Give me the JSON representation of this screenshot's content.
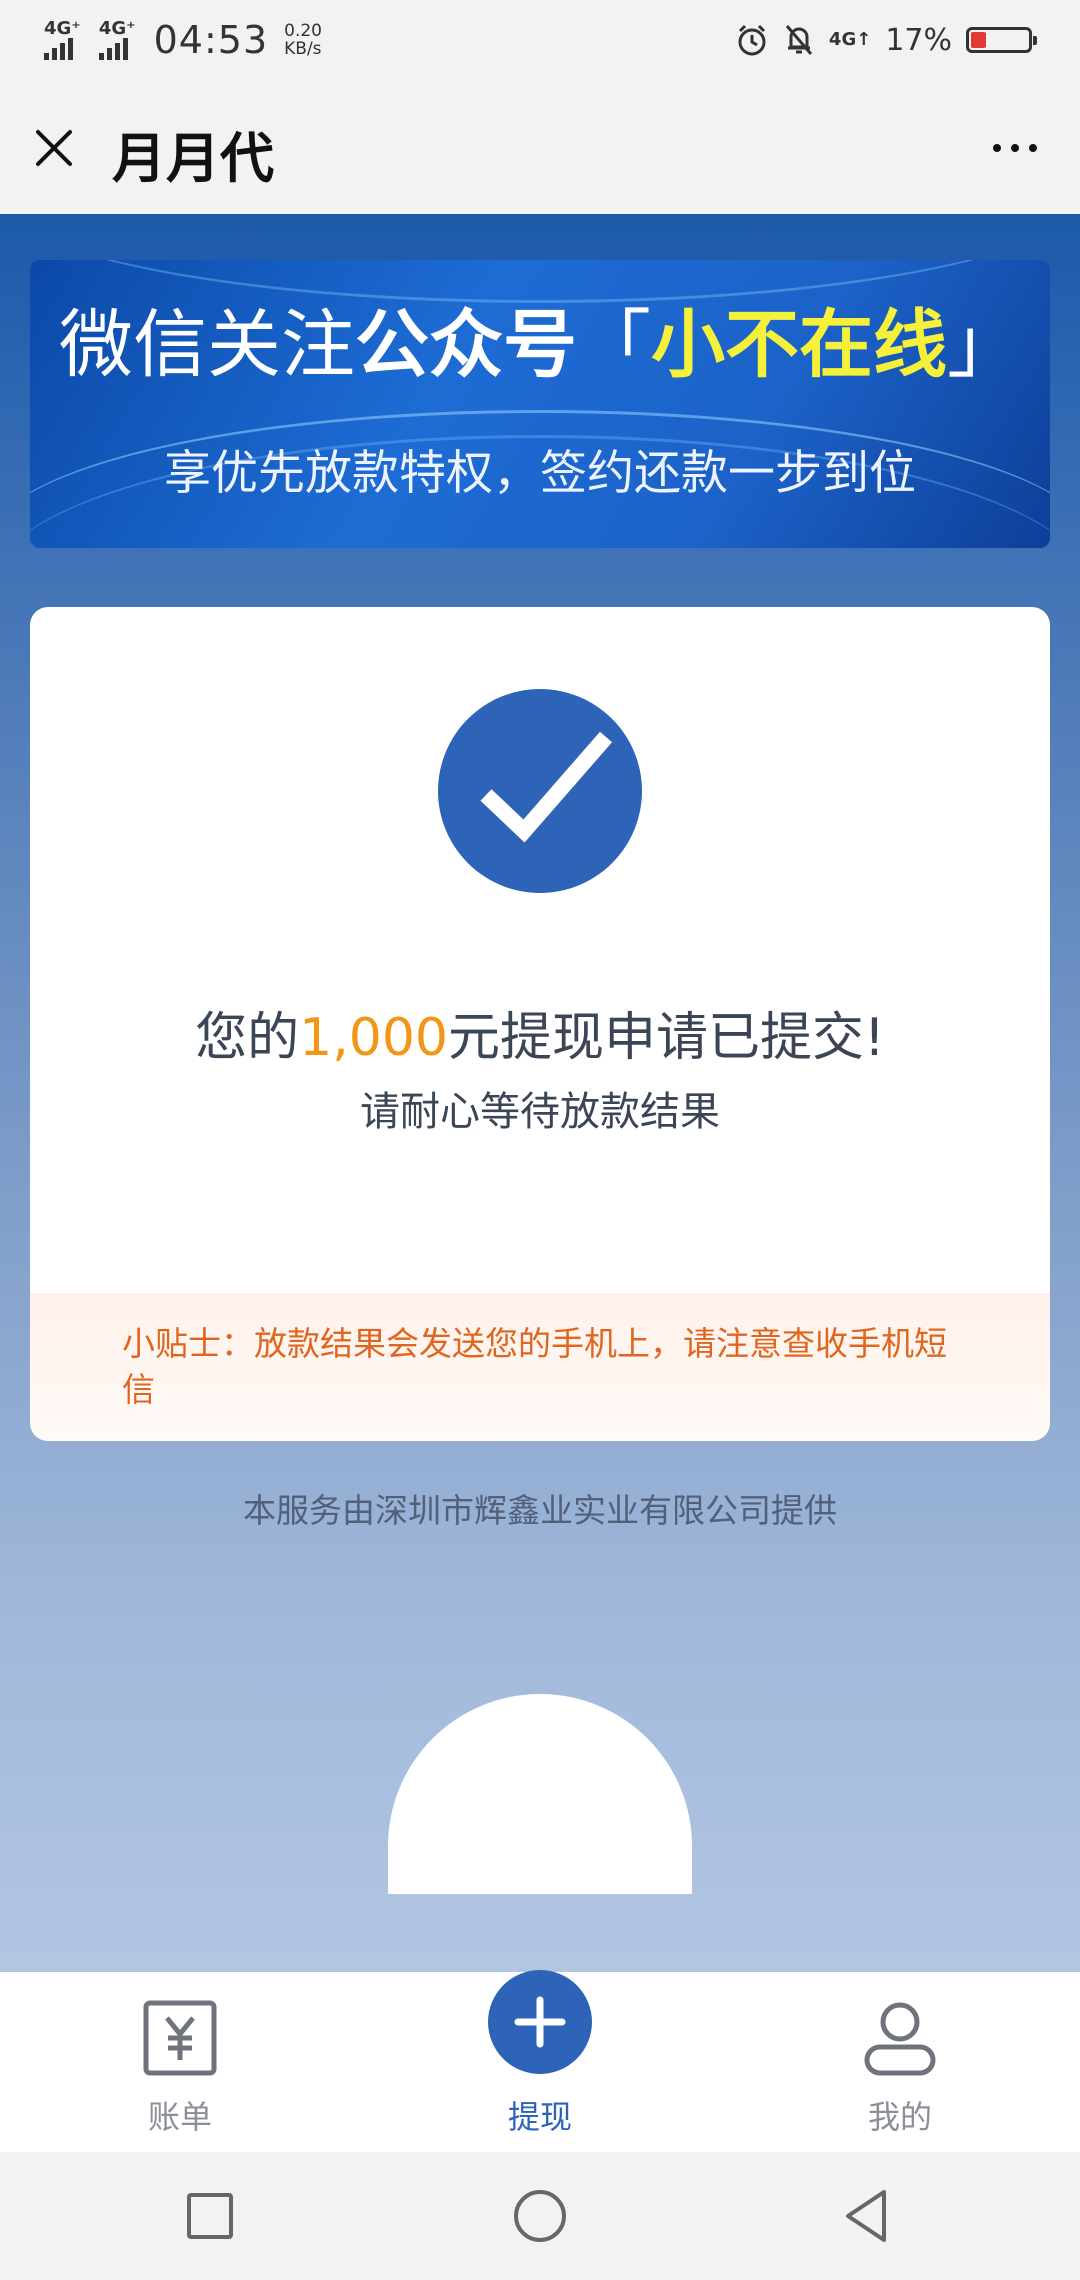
{
  "status_bar": {
    "signal_1": "4G⁺",
    "signal_2": "4G⁺",
    "time": "04:53",
    "speed_value": "0.20",
    "speed_unit": "KB/s",
    "network": "4G↑",
    "battery_text": "17%",
    "battery_level": 0.17,
    "battery_color": "#e53935"
  },
  "title_bar": {
    "title": "月月代",
    "close_icon": "close-icon",
    "more_icon": "more-icon"
  },
  "banner": {
    "line1_part1": "微信关注",
    "line1_part2": "公众号",
    "line1_part3": "「",
    "line1_part4": "小不在线",
    "line1_part5": "」",
    "line2": "享优先放款特权，签约还款一步到位"
  },
  "result": {
    "title_prefix": "您的",
    "amount": "1,000",
    "title_suffix": "元提现申请已提交!",
    "subtitle": "请耐心等待放款结果",
    "icon": "check-circle-icon",
    "icon_color": "#2e64b8",
    "amount_color": "#f29615"
  },
  "tip": {
    "text": "小贴士：放款结果会发送您的手机上，请注意查收手机短信"
  },
  "footer": {
    "provider": "本服务由深圳市辉鑫业实业有限公司提供"
  },
  "tabs": [
    {
      "label": "账单",
      "icon": "bill-yen-icon",
      "active": false
    },
    {
      "label": "提现",
      "icon": "plus-circle-icon",
      "active": true
    },
    {
      "label": "我的",
      "icon": "user-icon",
      "active": false
    }
  ],
  "colors": {
    "accent": "#2e64b8",
    "tip_text": "#e0661f"
  }
}
